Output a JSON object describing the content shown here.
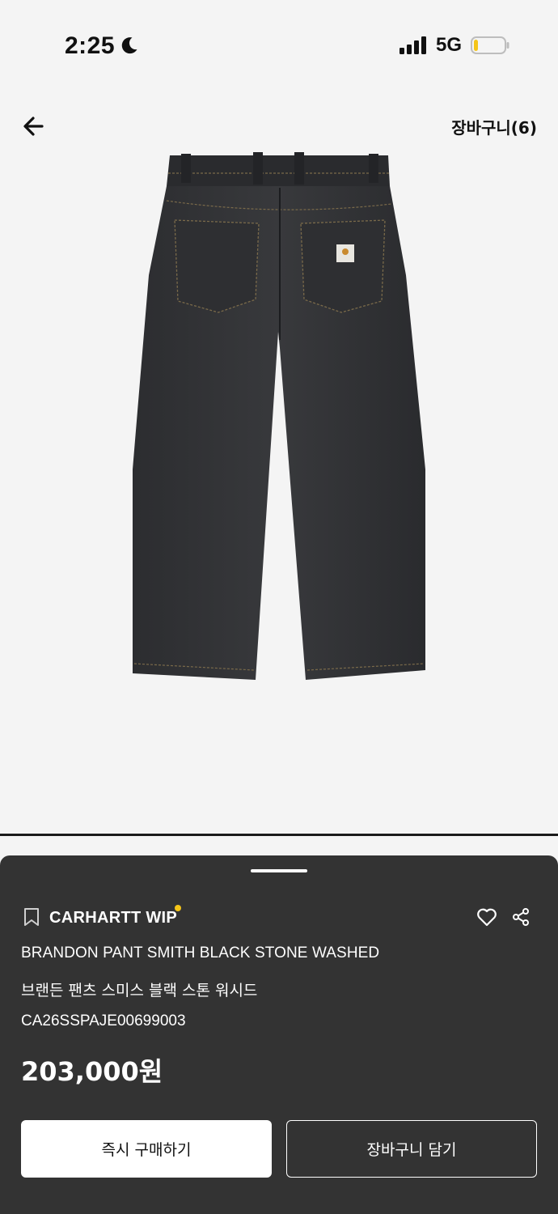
{
  "status_bar": {
    "time": "2:25",
    "network": "5G",
    "icons": [
      "moon-icon",
      "signal-icon",
      "battery-icon"
    ]
  },
  "nav": {
    "back_icon": "arrow-left-icon",
    "cart_label": "장바구니(6)"
  },
  "product": {
    "image": "product-image",
    "brand": "CARHARTT WIP",
    "name_en": "BRANDON PANT SMITH BLACK STONE WASHED",
    "name_ko": "브랜든 팬츠 스미스 블랙 스톤 워시드",
    "sku": "CA26SSPAJE00699003",
    "price": "203,000원"
  },
  "actions": {
    "buy_now": "즉시 구매하기",
    "add_to_cart": "장바구니 담기"
  },
  "colors": {
    "background": "#f4f4f4",
    "sheet": "#333333",
    "brand_dot": "#f5c518",
    "battery_fill": "#f5c518"
  }
}
